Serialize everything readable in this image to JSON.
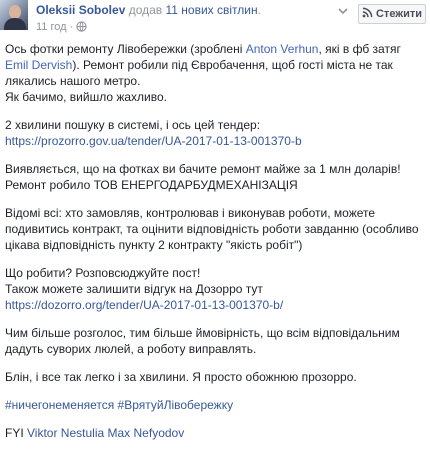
{
  "post": {
    "author": "Oleksii Sobolev",
    "action_prefix": "додав ",
    "action_count": "11 нових світлин",
    "action_suffix": ".",
    "date": "11 год",
    "dot": "·",
    "follow_label": "Стежити"
  },
  "body": {
    "p1_a": "Ось фотки ремонту Лівобережки (зроблені ",
    "p1_link1": "Anton Verhun",
    "p1_b": ", які в фб затяг ",
    "p1_link2": "Emil Dervish",
    "p1_c": "). Ремонт робили під Євробачення, щоб гості міста не так лякались нашого метро.",
    "p1_d": "Як бачимо, вийшло жахливо.",
    "p2_a": "2 хвилини пошуку в системі, і ось цей тендер:",
    "p2_link": "https://prozorro.gov.ua/tender/UA-2017-01-13-001370-b",
    "p3_a": "Виявляється, що на фотках ви бачите ремонт майже за 1 млн доларів!",
    "p3_b": "Ремонт робило ТОВ ЕНЕРГОДАРБУДМЕХАНІЗАЦІЯ",
    "p4": "Відомі всі: хто замовляв, контролював і виконував роботи, можете подивитись контракт, та оцінити відповідність роботи завданню (особливо цікава відповідність пункту 2 контракту \"якість робіт\")",
    "p5_a": "Що робити? Розповсюджуйте пост!",
    "p5_b": "Також можете залишити відгук на Дозорро тут",
    "p5_link": "https://dozorro.org/tender/UA-2017-01-13-001370-b/",
    "p6": "Чим більше розголос, тим більше ймовірність, що всім відповідальним дадуть суворих люлей, а роботу виправлять.",
    "p7": "Блін, і все так легко і за хвилини. Я просто обожнюю прозорро.",
    "p8_tag1": "#ничегонеменяется",
    "p8_tag2": "#ВрятуйЛівобережку",
    "p9_prefix": "FYI ",
    "p9_name1": "Viktor Nestulia",
    "p9_name2": "Max Nefyodov"
  },
  "icons": [
    "avatar",
    "globe-icon",
    "chevron-down-icon",
    "rss-icon"
  ],
  "colors": {
    "link": "#365899",
    "meta": "#90949c",
    "text": "#1d2129"
  }
}
